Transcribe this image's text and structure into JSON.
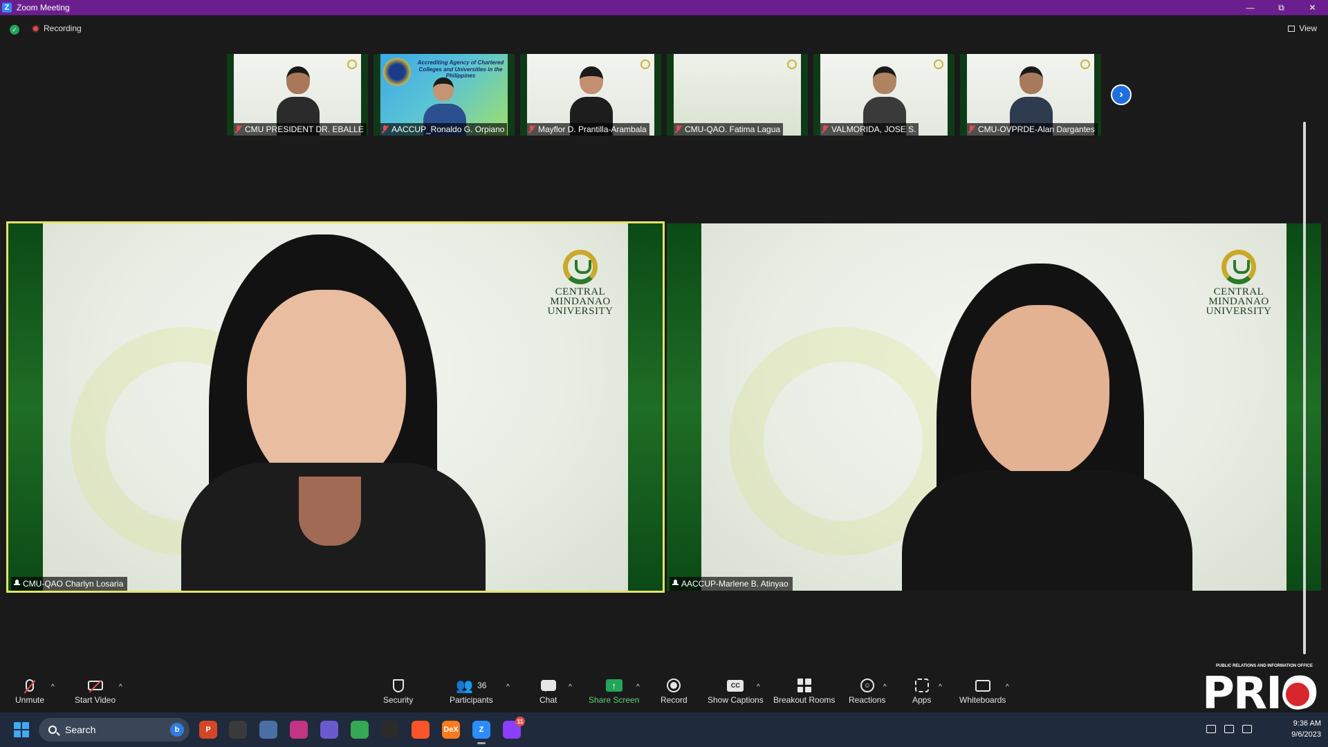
{
  "window": {
    "title": "Zoom Meeting",
    "controls": [
      "minimize",
      "restore",
      "close"
    ]
  },
  "topbar": {
    "security_icon": "shield-check-icon",
    "recording_label": "Recording",
    "view_label": "View"
  },
  "gallery": {
    "thumbnails": [
      {
        "name": "CMU PRESIDENT DR. EBALLE",
        "muted": true
      },
      {
        "name": "AACCUP_Ronaldo G. Orpiano",
        "muted": true,
        "banner": "Accrediting Agency of Chartered Colleges and Universities in the Philippines"
      },
      {
        "name": "Mayflor D. Prantilla-Arambala",
        "muted": true
      },
      {
        "name": "CMU-QAO. Fatima Lagua",
        "muted": true
      },
      {
        "name": "VALMORIDA, JOSE S.",
        "muted": true
      },
      {
        "name": "CMU-OVPRDE-Alan Dargantes",
        "muted": true
      }
    ],
    "next_icon": "chevron-right-icon"
  },
  "main_videos": [
    {
      "name": "CMU-QAO Charlyn Losaria",
      "active_speaker": true,
      "logo_text": [
        "CENTRAL",
        "MINDANAO",
        "UNIVERSITY"
      ]
    },
    {
      "name": "AACCUP-Marlene B. Atinyao",
      "active_speaker": false,
      "logo_text": [
        "CENTRAL",
        "MINDANAO",
        "UNIVERSITY"
      ]
    }
  ],
  "toolbar": {
    "unmute": "Unmute",
    "start_video": "Start Video",
    "security": "Security",
    "participants": "Participants",
    "participants_count": "36",
    "chat": "Chat",
    "share_screen": "Share Screen",
    "record": "Record",
    "show_captions": "Show Captions",
    "captions_icon_text": "CC",
    "breakout_rooms": "Breakout Rooms",
    "reactions": "Reactions",
    "apps": "Apps",
    "whiteboards": "Whiteboards"
  },
  "watermark": {
    "org_line": "PUBLIC RELATIONS AND INFORMATION OFFICE",
    "logo_text": "PRIO"
  },
  "taskbar": {
    "search_placeholder": "Search",
    "bing_label": "b",
    "apps": [
      {
        "name": "powerpoint-icon",
        "label": "P",
        "color": "#d24726"
      },
      {
        "name": "clock-icon",
        "label": "",
        "color": "#3a3a3a"
      },
      {
        "name": "calculator-icon",
        "label": "",
        "color": "#4a6fa5"
      },
      {
        "name": "instagram-icon",
        "label": "",
        "color": "#c13584"
      },
      {
        "name": "snipping-tool-icon",
        "label": "",
        "color": "#6a5acd"
      },
      {
        "name": "chrome-icon",
        "label": "",
        "color": "#34a853"
      },
      {
        "name": "obs-icon",
        "label": "",
        "color": "#2b2b2b"
      },
      {
        "name": "brave-icon",
        "label": "",
        "color": "#fb542b"
      },
      {
        "name": "dex-icon",
        "label": "DeX",
        "color": "#ff7a1a"
      },
      {
        "name": "zoom-icon",
        "label": "Z",
        "color": "#2d8cff"
      },
      {
        "name": "messenger-icon",
        "label": "",
        "color": "#8a3ffc",
        "badge": "11"
      }
    ],
    "time": "9:36 AM",
    "date": "9/6/2023"
  }
}
